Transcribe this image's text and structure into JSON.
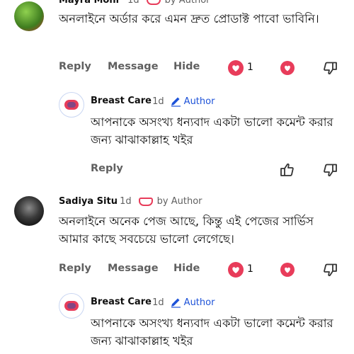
{
  "comments": [
    {
      "author": "Mayra Moni",
      "time": "1d",
      "badge": "by Author",
      "text": "অনলাইনে অর্ডার করে এমন দ্রুত প্রোডাক্ট পাবো ভাবিনি।",
      "reply_label": "Reply",
      "message_label": "Message",
      "hide_label": "Hide",
      "likes": "1"
    },
    {
      "author": "Sadiya Situ",
      "time": "1d",
      "badge": "by Author",
      "text": "অনলাইনে অনেক পেজ আছে, কিন্তু এই পেজের সার্ভিস আমার কাছে সবচেয়ে ভালো লেগেছে।",
      "reply_label": "Reply",
      "message_label": "Message",
      "hide_label": "Hide",
      "likes": "1"
    }
  ],
  "replies": [
    {
      "author": "Breast Care",
      "time": "1d",
      "badge": "Author",
      "text": "আপনাকে অসংখ্য ধন্যবাদ একটা ভালো কমেন্ট করার জন্য ঝাঝাকাল্লাহ খইর",
      "reply_label": "Reply"
    },
    {
      "author": "Breast Care",
      "time": "1d",
      "badge": "Author",
      "text": "আপনাকে অসংখ্য ধন্যবাদ একটা ভালো কমেন্ট করার জন্য ঝাঝাকাল্লাহ খইর"
    }
  ],
  "meta_separator": "·",
  "colors": {
    "heart": "#e83c5a",
    "author_blue": "#1d52d8",
    "secondary": "#606060"
  }
}
